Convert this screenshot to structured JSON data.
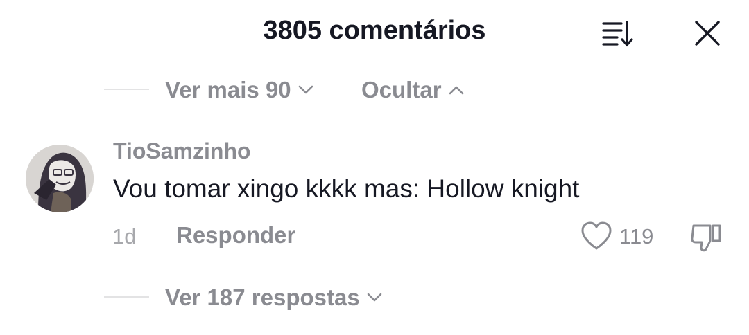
{
  "header": {
    "title": "3805 comentários",
    "sort_icon": "sort-list-icon",
    "close_icon": "close-icon"
  },
  "thread_controls": {
    "see_more_label": "Ver mais 90",
    "hide_label": "Ocultar"
  },
  "comment": {
    "username": "TioSamzinho",
    "text": "Vou tomar xingo kkkk mas: Hollow knight",
    "time": "1d",
    "reply_label": "Responder",
    "like_count": "119",
    "replies_label": "Ver 187 respostas"
  },
  "colors": {
    "primary_text": "#161823",
    "secondary_text": "#8a8b91",
    "divider": "#e3e3e4"
  }
}
